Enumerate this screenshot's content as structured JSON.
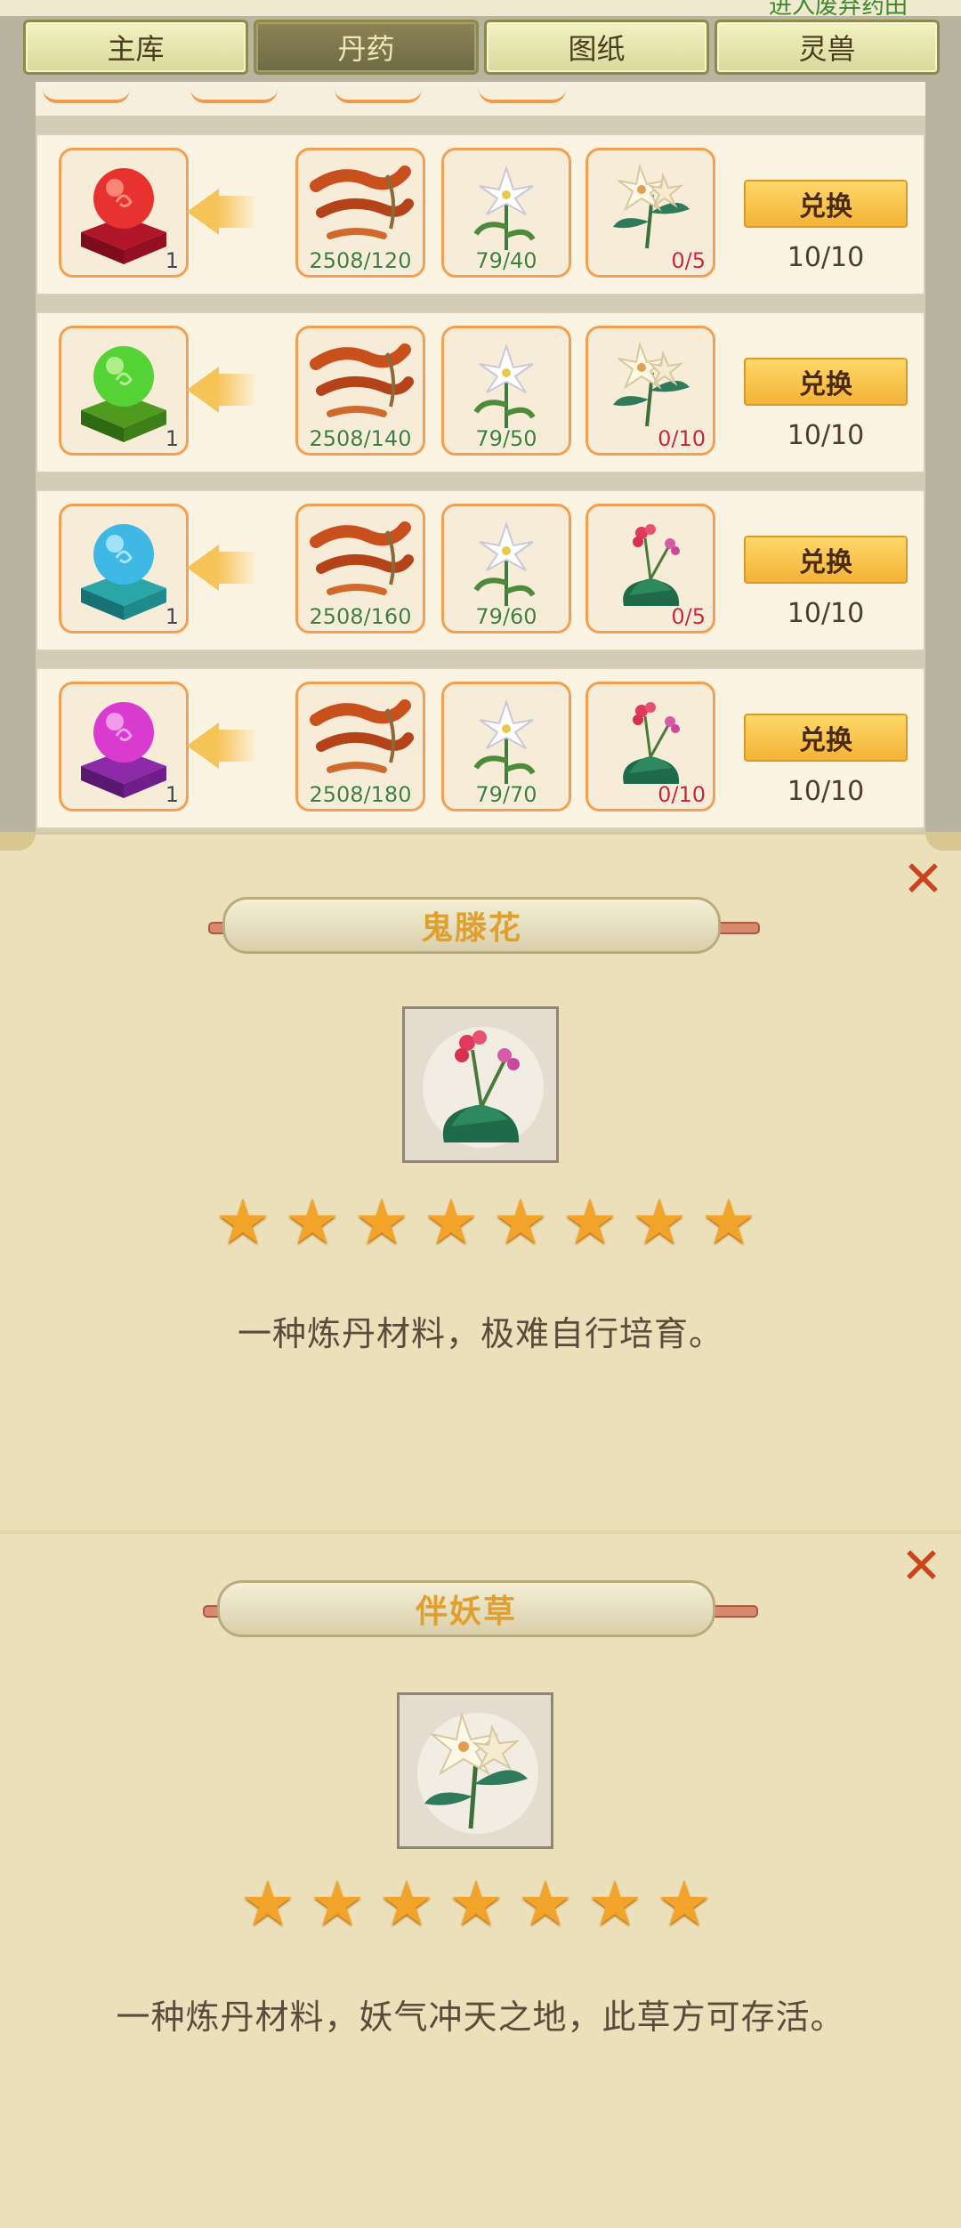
{
  "header": {
    "partial_text": "进入废弃药田"
  },
  "tabs": [
    {
      "label": "主库",
      "active": false
    },
    {
      "label": "丹药",
      "active": true
    },
    {
      "label": "图纸",
      "active": false
    },
    {
      "label": "灵兽",
      "active": false
    }
  ],
  "exchange_rows": [
    {
      "reward": {
        "icon": "red-orb-icon",
        "count": "1"
      },
      "costs": [
        {
          "icon": "ginseng-root-icon",
          "qty": "2508/120",
          "sufficient": true
        },
        {
          "icon": "white-lily-icon",
          "qty": "79/40",
          "sufficient": true
        },
        {
          "icon": "banyao-herb-icon",
          "qty": "0/5",
          "sufficient": false
        }
      ],
      "button": "兑换",
      "limit": "10/10"
    },
    {
      "reward": {
        "icon": "green-orb-icon",
        "count": "1"
      },
      "costs": [
        {
          "icon": "ginseng-root-icon",
          "qty": "2508/140",
          "sufficient": true
        },
        {
          "icon": "white-lily-icon",
          "qty": "79/50",
          "sufficient": true
        },
        {
          "icon": "banyao-herb-icon",
          "qty": "0/10",
          "sufficient": false
        }
      ],
      "button": "兑换",
      "limit": "10/10"
    },
    {
      "reward": {
        "icon": "cyan-orb-icon",
        "count": "1"
      },
      "costs": [
        {
          "icon": "ginseng-root-icon",
          "qty": "2508/160",
          "sufficient": true
        },
        {
          "icon": "white-lily-icon",
          "qty": "79/60",
          "sufficient": true
        },
        {
          "icon": "guiteng-flower-icon",
          "qty": "0/5",
          "sufficient": false
        }
      ],
      "button": "兑换",
      "limit": "10/10"
    },
    {
      "reward": {
        "icon": "purple-orb-icon",
        "count": "1"
      },
      "costs": [
        {
          "icon": "ginseng-root-icon",
          "qty": "2508/180",
          "sufficient": true
        },
        {
          "icon": "white-lily-icon",
          "qty": "79/70",
          "sufficient": true
        },
        {
          "icon": "guiteng-flower-icon",
          "qty": "0/10",
          "sufficient": false
        }
      ],
      "button": "兑换",
      "limit": "10/10"
    }
  ],
  "popups": [
    {
      "title": "鬼滕花",
      "icon": "guiteng-flower-icon",
      "stars": 8,
      "description": "一种炼丹材料，极难自行培育。"
    },
    {
      "title": "伴妖草",
      "icon": "banyao-herb-icon",
      "stars": 7,
      "description": "一种炼丹材料，妖气冲天之地，此草方可存活。"
    }
  ],
  "colors": {
    "orb_red": "#e8322f",
    "orb_green": "#55d235",
    "orb_cyan": "#3fb8e6",
    "orb_purple": "#d93bd0",
    "star": "#f2a42a",
    "qty_ok": "#3f7f34",
    "qty_short": "#d0242a",
    "close": "#c8451d",
    "title_text": "#e0a030"
  }
}
